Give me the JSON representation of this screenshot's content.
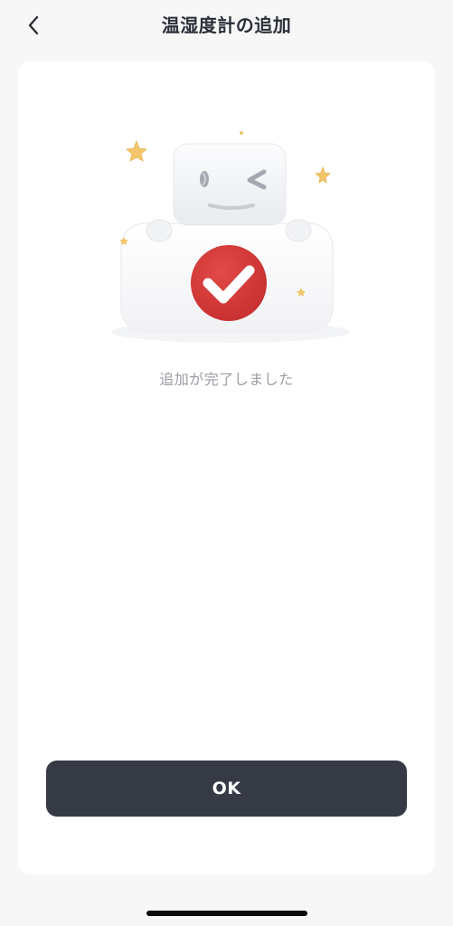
{
  "header": {
    "title": "温湿度計の追加",
    "back_icon": "chevron-left-icon"
  },
  "main": {
    "message": "追加が完了しました",
    "illustration_icon": "success-robot-illustration"
  },
  "footer": {
    "ok_label": "OK"
  },
  "colors": {
    "background": "#f7f7f7",
    "card": "#ffffff",
    "accent_red": "#d93a3a",
    "button": "#353a45",
    "message_text": "#9a9da3",
    "star": "#f3c66b"
  }
}
